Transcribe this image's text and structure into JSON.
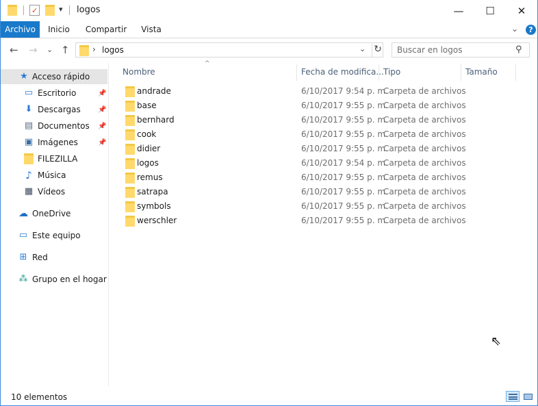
{
  "window": {
    "title": "logos",
    "controls": {
      "minimize": "—",
      "maximize": "☐",
      "close": "✕"
    }
  },
  "quick_access_toolbar": {
    "dropdown_glyph": "▾"
  },
  "ribbon": {
    "tabs": [
      {
        "label": "Archivo",
        "active": true
      },
      {
        "label": "Inicio",
        "active": false
      },
      {
        "label": "Compartir",
        "active": false
      },
      {
        "label": "Vista",
        "active": false
      }
    ],
    "expand_glyph": "⌄",
    "help_glyph": "?",
    "accent_color": "#1979ca"
  },
  "navigation": {
    "back_glyph": "←",
    "forward_glyph": "→",
    "recent_glyph": "⌄",
    "up_glyph": "↑"
  },
  "address_bar": {
    "separator": "›",
    "path": "logos",
    "dropdown_glyph": "⌄",
    "refresh_glyph": "↻"
  },
  "search": {
    "placeholder": "Buscar en logos",
    "value": "",
    "icon_glyph": "⚲"
  },
  "sidebar": {
    "items": [
      {
        "label": "Acceso rápido",
        "icon": "star-icon",
        "glyph": "★",
        "selected": true
      },
      {
        "label": "Escritorio",
        "icon": "desktop-icon",
        "glyph": "▭",
        "pinned": true
      },
      {
        "label": "Descargas",
        "icon": "download-icon",
        "glyph": "⬇",
        "pinned": true
      },
      {
        "label": "Documentos",
        "icon": "documents-icon",
        "glyph": "▤",
        "pinned": true
      },
      {
        "label": "Imágenes",
        "icon": "pictures-icon",
        "glyph": "▣",
        "pinned": true
      },
      {
        "label": "FILEZILLA",
        "icon": "folder-icon",
        "glyph": ""
      },
      {
        "label": "Música",
        "icon": "music-icon",
        "glyph": "♪"
      },
      {
        "label": "Vídeos",
        "icon": "videos-icon",
        "glyph": "▦"
      },
      {
        "label": "OneDrive",
        "icon": "cloud-icon",
        "glyph": "☁"
      },
      {
        "label": "Este equipo",
        "icon": "computer-icon",
        "glyph": "▭"
      },
      {
        "label": "Red",
        "icon": "network-icon",
        "glyph": "⊞"
      },
      {
        "label": "Grupo en el hogar",
        "icon": "homegroup-icon",
        "glyph": "⁂"
      }
    ],
    "pin_glyph": "📌"
  },
  "columns": {
    "name": "Nombre",
    "date": "Fecha de modifica...",
    "type": "Tipo",
    "size": "Tamaño",
    "sort_glyph": "^"
  },
  "files": [
    {
      "name": "andrade",
      "date": "6/10/2017 9:54 p. m.",
      "type": "Carpeta de archivos"
    },
    {
      "name": "base",
      "date": "6/10/2017 9:55 p. m.",
      "type": "Carpeta de archivos"
    },
    {
      "name": "bernhard",
      "date": "6/10/2017 9:55 p. m.",
      "type": "Carpeta de archivos"
    },
    {
      "name": "cook",
      "date": "6/10/2017 9:55 p. m.",
      "type": "Carpeta de archivos"
    },
    {
      "name": "didier",
      "date": "6/10/2017 9:55 p. m.",
      "type": "Carpeta de archivos"
    },
    {
      "name": "logos",
      "date": "6/10/2017 9:54 p. m.",
      "type": "Carpeta de archivos"
    },
    {
      "name": "remus",
      "date": "6/10/2017 9:55 p. m.",
      "type": "Carpeta de archivos"
    },
    {
      "name": "satrapa",
      "date": "6/10/2017 9:55 p. m.",
      "type": "Carpeta de archivos"
    },
    {
      "name": "symbols",
      "date": "6/10/2017 9:55 p. m.",
      "type": "Carpeta de archivos"
    },
    {
      "name": "werschler",
      "date": "6/10/2017 9:55 p. m.",
      "type": "Carpeta de archivos"
    }
  ],
  "status": {
    "count_text": "10 elementos"
  },
  "colors": {
    "folder": "#ffd96b",
    "header_text": "#4c607a",
    "selection": "#e5e5e5"
  }
}
